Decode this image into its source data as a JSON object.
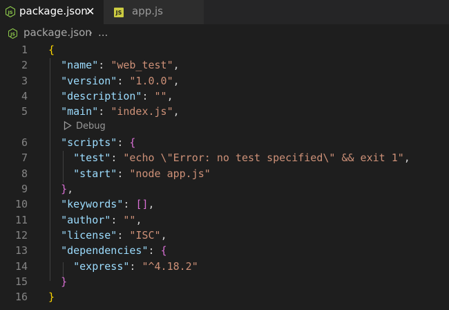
{
  "tabs": [
    {
      "label": "package.json",
      "icon": "nodejs-icon",
      "active": true
    },
    {
      "label": "app.js",
      "icon": "js-file-icon",
      "active": false
    }
  ],
  "breadcrumb": {
    "file": "package.json",
    "more": "..."
  },
  "codelens": {
    "label": "Debug"
  },
  "lines": [
    {
      "num": "1",
      "tokens": [
        {
          "t": "{",
          "c": "b1"
        }
      ]
    },
    {
      "num": "2",
      "tokens": [
        {
          "t": "  "
        },
        {
          "t": "\"name\"",
          "c": "k"
        },
        {
          "t": ": ",
          "c": "p"
        },
        {
          "t": "\"web_test\"",
          "c": "s"
        },
        {
          "t": ",",
          "c": "p"
        }
      ]
    },
    {
      "num": "3",
      "tokens": [
        {
          "t": "  "
        },
        {
          "t": "\"version\"",
          "c": "k"
        },
        {
          "t": ": ",
          "c": "p"
        },
        {
          "t": "\"1.0.0\"",
          "c": "s"
        },
        {
          "t": ",",
          "c": "p"
        }
      ]
    },
    {
      "num": "4",
      "tokens": [
        {
          "t": "  "
        },
        {
          "t": "\"description\"",
          "c": "k"
        },
        {
          "t": ": ",
          "c": "p"
        },
        {
          "t": "\"\"",
          "c": "s"
        },
        {
          "t": ",",
          "c": "p"
        }
      ]
    },
    {
      "num": "5",
      "tokens": [
        {
          "t": "  "
        },
        {
          "t": "\"main\"",
          "c": "k"
        },
        {
          "t": ": ",
          "c": "p"
        },
        {
          "t": "\"index.js\"",
          "c": "s"
        },
        {
          "t": ",",
          "c": "p"
        }
      ]
    },
    {
      "num": "6",
      "tokens": [
        {
          "t": "  "
        },
        {
          "t": "\"scripts\"",
          "c": "k"
        },
        {
          "t": ": ",
          "c": "p"
        },
        {
          "t": "{",
          "c": "b2"
        }
      ]
    },
    {
      "num": "7",
      "tokens": [
        {
          "t": "    "
        },
        {
          "t": "\"test\"",
          "c": "k"
        },
        {
          "t": ": ",
          "c": "p"
        },
        {
          "t": "\"echo \\\"Error: no test specified\\\" && exit 1\"",
          "c": "s"
        },
        {
          "t": ",",
          "c": "p"
        }
      ]
    },
    {
      "num": "8",
      "tokens": [
        {
          "t": "    "
        },
        {
          "t": "\"start\"",
          "c": "k"
        },
        {
          "t": ": ",
          "c": "p"
        },
        {
          "t": "\"node app.js\"",
          "c": "s"
        }
      ]
    },
    {
      "num": "9",
      "tokens": [
        {
          "t": "  "
        },
        {
          "t": "}",
          "c": "b2"
        },
        {
          "t": ",",
          "c": "p"
        }
      ]
    },
    {
      "num": "10",
      "tokens": [
        {
          "t": "  "
        },
        {
          "t": "\"keywords\"",
          "c": "k"
        },
        {
          "t": ": ",
          "c": "p"
        },
        {
          "t": "[]",
          "c": "b2"
        },
        {
          "t": ",",
          "c": "p"
        }
      ]
    },
    {
      "num": "11",
      "tokens": [
        {
          "t": "  "
        },
        {
          "t": "\"author\"",
          "c": "k"
        },
        {
          "t": ": ",
          "c": "p"
        },
        {
          "t": "\"\"",
          "c": "s"
        },
        {
          "t": ",",
          "c": "p"
        }
      ]
    },
    {
      "num": "12",
      "tokens": [
        {
          "t": "  "
        },
        {
          "t": "\"license\"",
          "c": "k"
        },
        {
          "t": ": ",
          "c": "p"
        },
        {
          "t": "\"ISC\"",
          "c": "s"
        },
        {
          "t": ",",
          "c": "p"
        }
      ]
    },
    {
      "num": "13",
      "tokens": [
        {
          "t": "  "
        },
        {
          "t": "\"dependencies\"",
          "c": "k"
        },
        {
          "t": ": ",
          "c": "p"
        },
        {
          "t": "{",
          "c": "b2"
        }
      ]
    },
    {
      "num": "14",
      "tokens": [
        {
          "t": "    "
        },
        {
          "t": "\"express\"",
          "c": "k"
        },
        {
          "t": ": ",
          "c": "p"
        },
        {
          "t": "\"^4.18.2\"",
          "c": "s"
        }
      ]
    },
    {
      "num": "15",
      "tokens": [
        {
          "t": "  "
        },
        {
          "t": "}",
          "c": "b2"
        }
      ]
    },
    {
      "num": "16",
      "tokens": [
        {
          "t": "}",
          "c": "b1"
        }
      ]
    }
  ],
  "colors": {
    "background": "#1e1e1e",
    "key": "#9cdcfe",
    "string": "#ce9178",
    "bracket_outer": "#ffd700",
    "bracket_inner": "#da70d6"
  }
}
